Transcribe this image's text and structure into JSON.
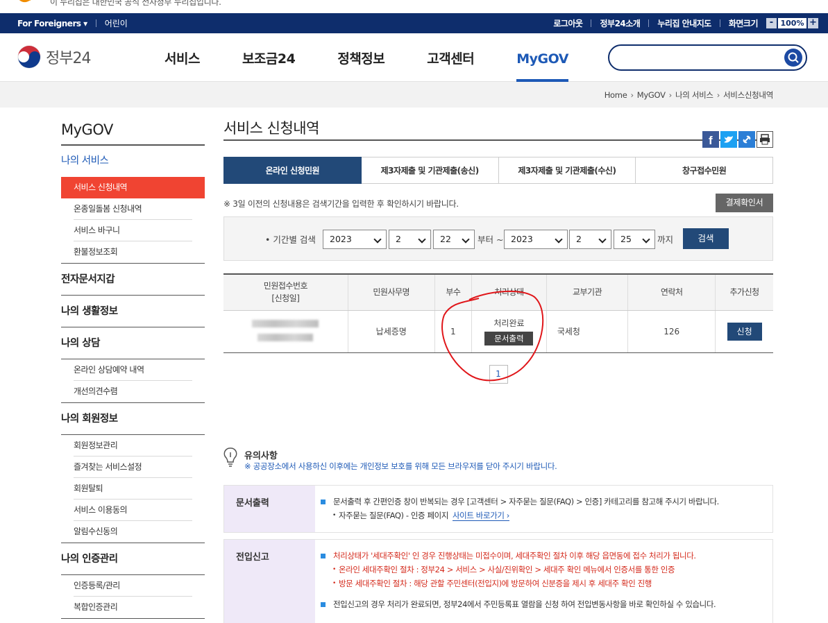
{
  "gov_banner": {
    "text": "이 누리집은 대한민국 공식 전자정부 누리집입니다."
  },
  "topbar": {
    "foreigners": "For Foreigners ▾",
    "kids": "어린이",
    "logout": "로그아웃",
    "intro": "정부24소개",
    "sitemap": "누리집 안내지도",
    "screen_size": "화면크기",
    "zoom_minus": "-",
    "zoom": "100%",
    "zoom_plus": "+"
  },
  "header": {
    "brand": "정부24",
    "nav": [
      "서비스",
      "보조금24",
      "정책정보",
      "고객센터",
      "MyGOV"
    ],
    "active_nav": "MyGOV",
    "search_placeholder": ""
  },
  "breadcrumb": [
    "Home",
    "MyGOV",
    "나의 서비스",
    "서비스신청내역"
  ],
  "lnb": {
    "title": "MyGOV",
    "my_service": "나의 서비스",
    "my_service_items": [
      "서비스 신청내역",
      "온종일돌봄 신청내역",
      "서비스 바구니",
      "환불정보조회"
    ],
    "e_wallet": "전자문서지갑",
    "life_info": "나의 생활정보",
    "consult": "나의 상담",
    "consult_items": [
      "온라인 상담예약 내역",
      "개선의견수렴"
    ],
    "member": "나의 회원정보",
    "member_items": [
      "회원정보관리",
      "즐겨찾는 서비스설정",
      "회원탈퇴",
      "서비스 이용동의",
      "알림수신동의"
    ],
    "auth": "나의 인증관리",
    "auth_items": [
      "인증등록/관리",
      "복합인증관리"
    ]
  },
  "page": {
    "title": "서비스 신청내역",
    "tabs": [
      "온라인 신청민원",
      "제3자제출 및 기관제출(송신)",
      "제3자제출 및 기관제출(수신)",
      "창구접수민원"
    ],
    "notice": "※ 3일 이전의 신청내용은 검색기간을 입력한 후 확인하시기 바랍니다.",
    "confirm_btn": "결제확인서"
  },
  "filter": {
    "label": "• 기간별 검색",
    "from_year": "2023",
    "from_month": "2",
    "from_day": "22",
    "from_text": "부터 ~",
    "to_year": "2023",
    "to_month": "2",
    "to_day": "25",
    "to_text": "까지",
    "search_btn": "검색"
  },
  "table": {
    "headers": [
      "민원접수번호",
      "[신청일]",
      "민원사무명",
      "부수",
      "처리상태",
      "교부기관",
      "연락처",
      "추가신청"
    ],
    "row": {
      "service": "납세증명",
      "copies": "1",
      "status": "처리완료",
      "doc_btn": "문서출력",
      "agency": "국세청",
      "contact": "126",
      "apply_btn": "신청"
    }
  },
  "pagination": {
    "current": "1"
  },
  "caution": {
    "title": "유의사항",
    "desc": "※ 공공장소에서 사용하신 이후에는 개인정보 보호를 위해 모든 브라우저를 닫아 주시기 바랍니다."
  },
  "box_print": {
    "label": "문서출력",
    "line1": "문서출력 후 간편인증 창이 반복되는 경우 [고객센터 > 자주묻는 질문(FAQ) > 인증] 카테고리를 참고해 주시기 바랍니다.",
    "line2": "자주묻는 질문(FAQ) - 인증 페이지",
    "link": "사이트 바로가기 ›"
  },
  "box_move": {
    "label": "전입신고",
    "line1": "처리상태가 '세대주확인' 인 경우 진행상태는 미접수이며, 세대주확인 절차 이후 해당 읍면동에 접수 처리가 됩니다.",
    "line2": "온라인 세대주확인 절차 : 정부24 > 서비스 > 사실/진위확인 > 세대주 확인 메뉴에서 인증서를 통한 인증",
    "line3": "방문 세대주확인 절차 : 해당 관할 주민센터(전입지)에 방문하여 신분증을 제시 후 세대주 확인 진행",
    "line4": "전입신고의 경우 처리가 완료되면, 정부24에서 주민등록표 열람을 신청 하여 전입변동사항을 바로 확인하실 수 있습니다."
  },
  "colors": {
    "navy": "#0e2d6c",
    "accent_blue": "#1d59b6",
    "active_red": "#f04432",
    "tab_navy": "#224978",
    "annotation_red": "#e0161a"
  }
}
